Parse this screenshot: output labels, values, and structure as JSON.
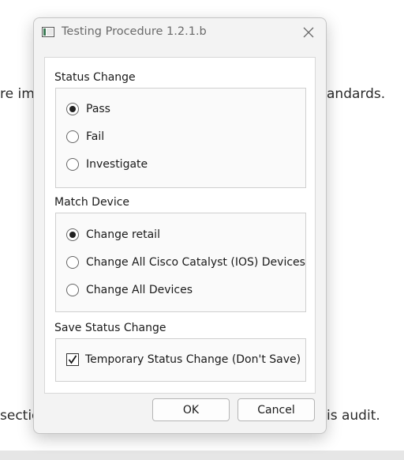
{
  "background": {
    "line1_left": "re im",
    "line1_right": "andards.",
    "line2_left": "sectio",
    "line2_right": "is audit."
  },
  "dialog": {
    "title": "Testing Procedure 1.2.1.b",
    "groups": [
      {
        "label": "Status Change",
        "type": "radio",
        "options": [
          {
            "label": "Pass",
            "checked": true
          },
          {
            "label": "Fail",
            "checked": false
          },
          {
            "label": "Investigate",
            "checked": false
          }
        ]
      },
      {
        "label": "Match Device",
        "type": "radio",
        "options": [
          {
            "label": "Change retail",
            "checked": true
          },
          {
            "label": "Change All Cisco Catalyst (IOS) Devices",
            "checked": false
          },
          {
            "label": "Change All Devices",
            "checked": false
          }
        ]
      },
      {
        "label": "Save Status Change",
        "type": "checkbox",
        "options": [
          {
            "label": "Temporary Status Change (Don't Save)",
            "checked": true
          }
        ]
      }
    ],
    "buttons": {
      "ok": "OK",
      "cancel": "Cancel"
    }
  }
}
